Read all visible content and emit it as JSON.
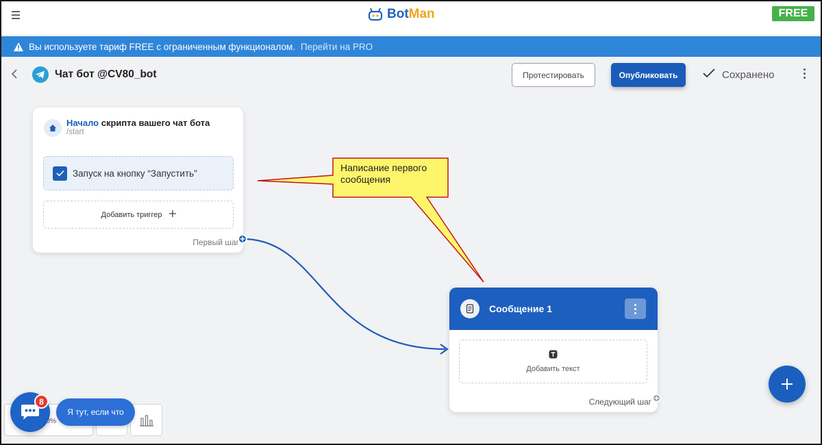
{
  "app": {
    "logo_bot": "Bot",
    "logo_man": "Man",
    "plan_badge": "FREE"
  },
  "banner": {
    "message": "Вы используете тариф FREE с ограниченным функционалом.",
    "link": "Перейти на PRO"
  },
  "header": {
    "bot_title": "Чат бот @CV80_bot",
    "test_button": "Протестировать",
    "publish_button": "Опубликовать",
    "saved_status": "Сохранено"
  },
  "start_card": {
    "title_accent": "Начало",
    "title_rest": " скрипта вашего чат бота",
    "command": "/start",
    "trigger_label": "Запуск на кнопку “Запустить”",
    "add_trigger_label": "Добавить триггер",
    "first_step_label": "Первый шаг"
  },
  "callout": {
    "text": "Написание первого сообщения"
  },
  "message_card": {
    "title": "Сообщение 1",
    "add_text_label": "Добавить текст",
    "next_step_label": "Следующий шаг"
  },
  "toolbar": {
    "zoom_level": "0%"
  },
  "chat_widget": {
    "badge_count": "8",
    "prompt": "Я тут, если что"
  },
  "colors": {
    "primary": "#1d5fbf",
    "banner": "#2f86d9",
    "free_badge": "#46b14a",
    "logo_accent": "#f0a41d",
    "callout_fill": "#fdf66b",
    "callout_border": "#c4161c",
    "badge_red": "#e53b2f"
  }
}
